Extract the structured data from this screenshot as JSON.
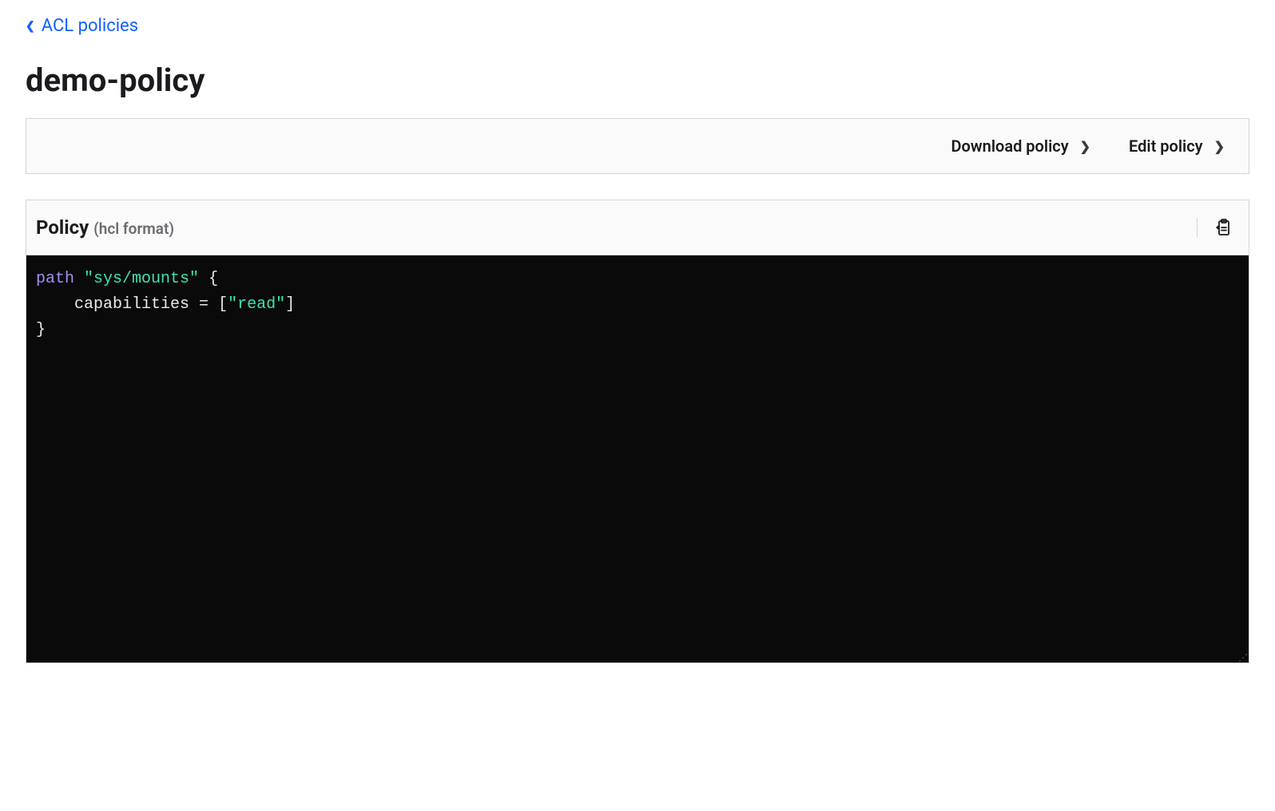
{
  "breadcrumb": {
    "parent_label": "ACL policies"
  },
  "page": {
    "title": "demo-policy"
  },
  "toolbar": {
    "download_label": "Download policy",
    "edit_label": "Edit policy"
  },
  "policy_panel": {
    "label": "Policy",
    "format_label": "(hcl format)"
  },
  "code": {
    "line1_keyword": "path",
    "line1_string": "\"sys/mounts\"",
    "line1_brace": " {",
    "line2_indent": "    ",
    "line2_attr": "capabilities",
    "line2_eq": " = ",
    "line2_lbracket": "[",
    "line2_string": "\"read\"",
    "line2_rbracket": "]",
    "line3_brace": "}"
  }
}
